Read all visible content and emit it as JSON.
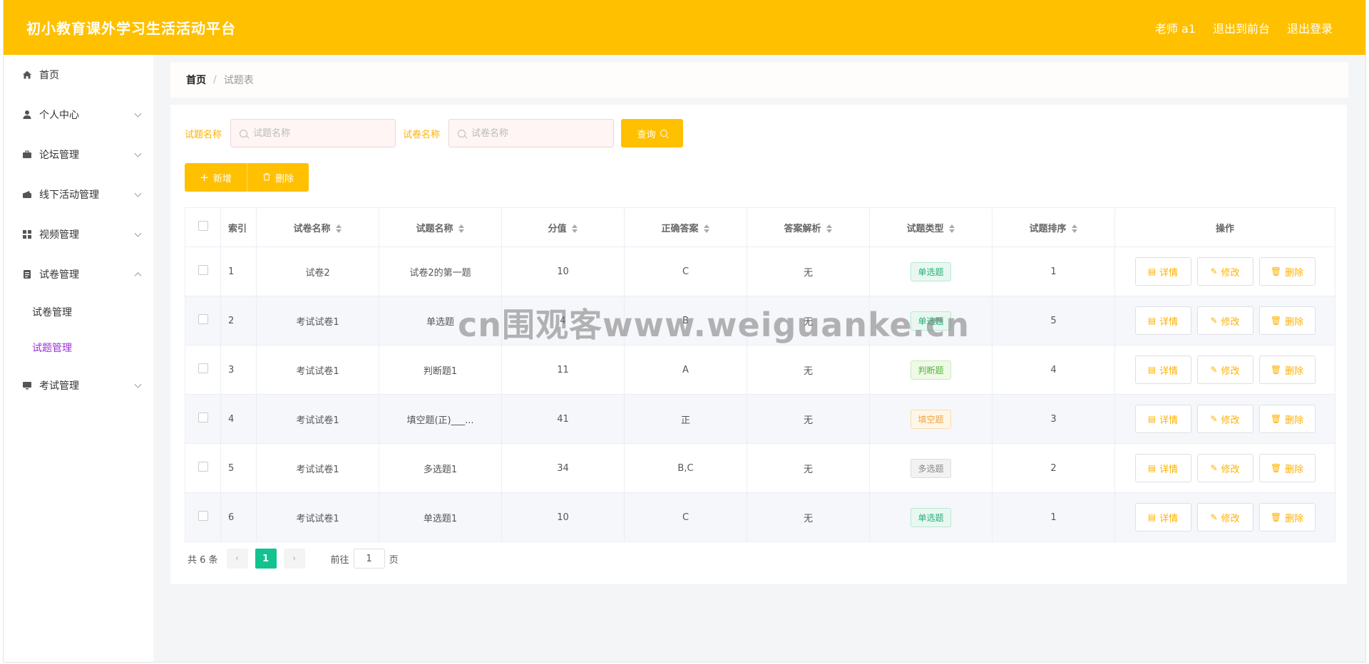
{
  "header": {
    "app_title": "初小教育课外学习生活活动平台",
    "links": [
      "老师 a1",
      "退出到前台",
      "退出登录"
    ]
  },
  "sidebar": {
    "items": [
      {
        "label": "首页",
        "icon": "home-icon"
      },
      {
        "label": "个人中心",
        "icon": "user-icon"
      },
      {
        "label": "论坛管理",
        "icon": "briefcase-icon"
      },
      {
        "label": "线下活动管理",
        "icon": "wallet-icon"
      },
      {
        "label": "视频管理",
        "icon": "grid-icon"
      },
      {
        "label": "试卷管理",
        "icon": "document-icon"
      },
      {
        "label": "考试管理",
        "icon": "monitor-icon"
      }
    ],
    "sub_items": [
      "试卷管理",
      "试题管理"
    ]
  },
  "breadcrumb": {
    "home": "首页",
    "separator": "/",
    "current": "试题表"
  },
  "search": {
    "question_label": "试题名称",
    "question_placeholder": "试题名称",
    "paper_label": "试卷名称",
    "paper_placeholder": "试卷名称",
    "query_button": "查询"
  },
  "actions": {
    "add": "新增",
    "delete": "删除"
  },
  "table": {
    "headers": [
      "索引",
      "试卷名称",
      "试题名称",
      "分值",
      "正确答案",
      "答案解析",
      "试题类型",
      "试题排序",
      "操作"
    ],
    "rows": [
      {
        "idx": "1",
        "paper": "试卷2",
        "question": "试卷2的第一题",
        "score": "10",
        "answer": "C",
        "analysis": "无",
        "type": "单选题",
        "type_style": "single",
        "order": "1"
      },
      {
        "idx": "2",
        "paper": "考试试卷1",
        "question": "单选题",
        "score": "4",
        "answer": "B",
        "analysis": "无",
        "type": "单选题",
        "type_style": "single",
        "order": "5"
      },
      {
        "idx": "3",
        "paper": "考试试卷1",
        "question": "判断题1",
        "score": "11",
        "answer": "A",
        "analysis": "无",
        "type": "判断题",
        "type_style": "judge",
        "order": "4"
      },
      {
        "idx": "4",
        "paper": "考试试卷1",
        "question": "填空题(正)___...",
        "score": "41",
        "answer": "正",
        "analysis": "无",
        "type": "填空题",
        "type_style": "fill",
        "order": "3"
      },
      {
        "idx": "5",
        "paper": "考试试卷1",
        "question": "多选题1",
        "score": "34",
        "answer": "B,C",
        "analysis": "无",
        "type": "多选题",
        "type_style": "multi",
        "order": "2"
      },
      {
        "idx": "6",
        "paper": "考试试卷1",
        "question": "单选题1",
        "score": "10",
        "answer": "C",
        "analysis": "无",
        "type": "单选题",
        "type_style": "single",
        "order": "1"
      }
    ],
    "row_actions": {
      "detail": "详情",
      "edit": "修改",
      "delete": "删除"
    }
  },
  "pagination": {
    "total": "共 6 条",
    "current_page": "1",
    "goto_label": "前往",
    "goto_value": "1",
    "unit": "页"
  },
  "watermark": "cn围观客www.weiguanke.cn",
  "colors": {
    "brand": "#ffc000",
    "active_menu": "#9b30d8",
    "page_active": "#12c28f"
  }
}
